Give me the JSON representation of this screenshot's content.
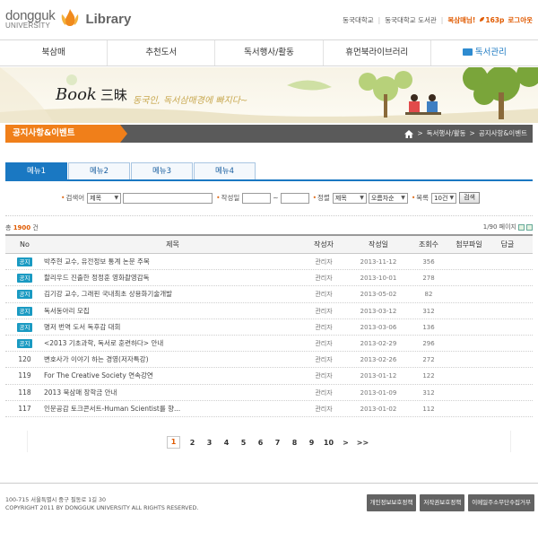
{
  "header": {
    "logo_line1": "dongguk",
    "logo_line2": "UNIVERSITY",
    "logo_library": "Library",
    "links": [
      "동국대학교",
      "동국대학교 도서관"
    ],
    "user_label": "복삼매님!",
    "points": "163p",
    "logout": "로그아웃"
  },
  "gnb": [
    "북삼매",
    "추천도서",
    "독서행사/활동",
    "휴먼북라이브러리",
    "독서관리"
  ],
  "banner": {
    "title": "Book",
    "title_han": "三昧",
    "slogan": "동국인, 독서삼매경에 빠지다~"
  },
  "page": {
    "title": "공지사항&이벤트",
    "breadcrumb": [
      "독서행사/활동",
      "공지사항&이벤트"
    ]
  },
  "tabs": [
    "메뉴1",
    "메뉴2",
    "메뉴3",
    "메뉴4"
  ],
  "search": {
    "field_label": "검색어",
    "field_select": "제목",
    "date_label": "작성일",
    "date_sep": "~",
    "sort_label": "정렬",
    "sort_field": "제목",
    "sort_order": "오름차순",
    "size_label": "목록",
    "size_value": "10건",
    "button": "검색"
  },
  "summary": {
    "total_label": "총",
    "total": "1900",
    "total_unit": "건",
    "page_info": "1/90 페이지"
  },
  "table": {
    "headers": [
      "No",
      "제목",
      "작성자",
      "작성일",
      "조회수",
      "첨부파일",
      "답글"
    ],
    "rows": [
      {
        "no": "공지",
        "title": "박주현 교수, 유전정보 통계 논문 주목",
        "author": "관리자",
        "date": "2013-11-12",
        "views": "356"
      },
      {
        "no": "공지",
        "title": "할리우드 진출한 정정훈 영화촬영감독",
        "author": "관리자",
        "date": "2013-10-01",
        "views": "278"
      },
      {
        "no": "공지",
        "title": "김기강 교수, 그래핀 국내최초 상용화기술개발",
        "author": "관리자",
        "date": "2013-05-02",
        "views": "82"
      },
      {
        "no": "공지",
        "title": "독서동아리 모집",
        "author": "관리자",
        "date": "2013-03-12",
        "views": "312"
      },
      {
        "no": "공지",
        "title": "명저 번역 도서 독후감 대회",
        "author": "관리자",
        "date": "2013-03-06",
        "views": "136"
      },
      {
        "no": "공지",
        "title": "<2013 기초과학, 독서로 훈련하다> 안내",
        "author": "관리자",
        "date": "2013-02-29",
        "views": "296"
      },
      {
        "no": "120",
        "title": "변호사가 이야기 하는 경영(저자특강)",
        "author": "관리자",
        "date": "2013-02-26",
        "views": "272"
      },
      {
        "no": "119",
        "title": "For The Creative Society 연속강연",
        "author": "관리자",
        "date": "2013-01-12",
        "views": "122"
      },
      {
        "no": "118",
        "title": "2013 북삼매 장학금 안내",
        "author": "관리자",
        "date": "2013-01-09",
        "views": "312"
      },
      {
        "no": "117",
        "title": "인문공감 토크콘서트-Human Scientist를 향...",
        "author": "관리자",
        "date": "2013-01-02",
        "views": "112"
      }
    ]
  },
  "pager": {
    "pages": [
      "1",
      "2",
      "3",
      "4",
      "5",
      "6",
      "7",
      "8",
      "9",
      "10"
    ],
    "next": ">",
    "last": ">>"
  },
  "footer": {
    "address": "100-715 서울특별시 중구 필동로 1길 30",
    "copyright": "COPYRIGHT 2011 BY  DONGGUK UNIVERSITY ALL RIGHTS RESERVED.",
    "buttons": [
      "개인정보보호정책",
      "저작권보호정책",
      "이메일주소무단수집거부"
    ]
  },
  "colors": {
    "accent_orange": "#f07f1a",
    "accent_blue": "#1a78c2",
    "badge": "#1a9ac2"
  }
}
